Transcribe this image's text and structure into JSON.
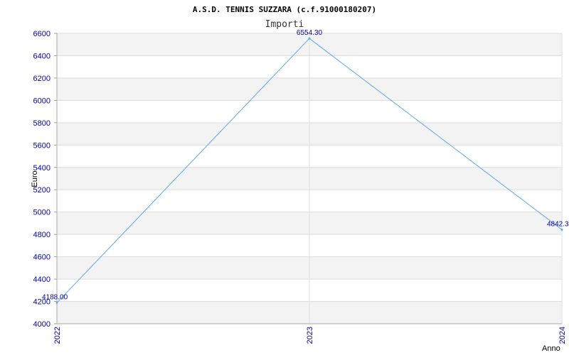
{
  "chart_data": {
    "type": "line",
    "title": "A.S.D. TENNIS SUZZARA (c.f.91000180207)",
    "subtitle": "Importi",
    "xlabel": "Anno",
    "ylabel": "Euro",
    "categories": [
      "2022",
      "2023",
      "2024"
    ],
    "series": [
      {
        "values": [
          4188.0,
          6554.3,
          4842.3
        ]
      }
    ],
    "data_labels": [
      "4188.00",
      "6554.30",
      "4842.30"
    ],
    "ylim": [
      4000,
      6600
    ],
    "yticks": [
      4000,
      4200,
      4400,
      4600,
      4800,
      5000,
      5200,
      5400,
      5600,
      5800,
      6000,
      6200,
      6400,
      6600
    ],
    "grid": true,
    "colors": {
      "line": "#5fa8ef",
      "band": "#f3f3f3",
      "tick": "#0000aa",
      "grid": "#dddddd"
    }
  }
}
